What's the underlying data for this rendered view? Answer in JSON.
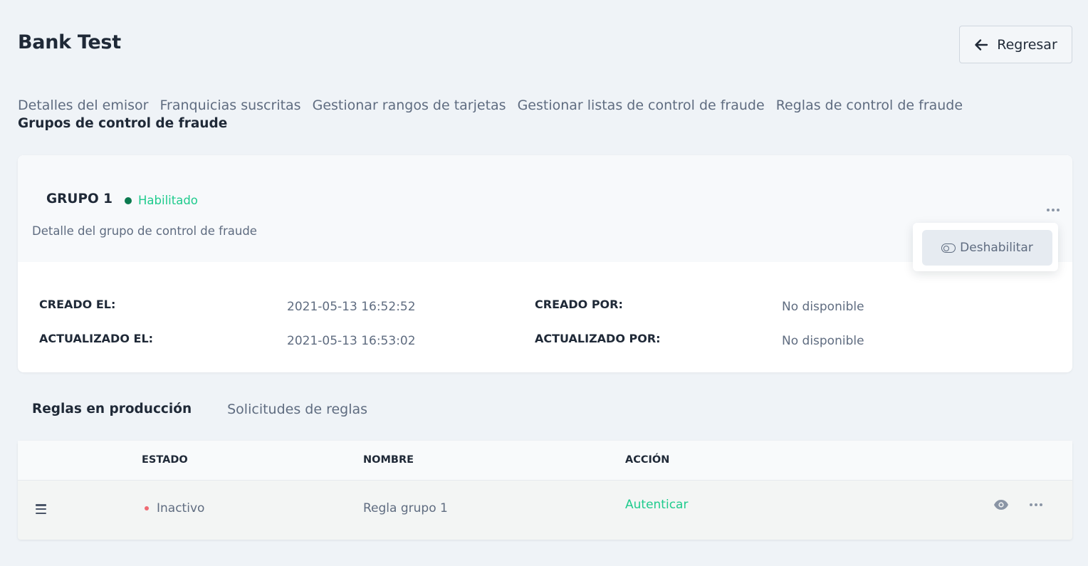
{
  "header": {
    "title": "Bank Test",
    "back_label": "Regresar"
  },
  "nav": {
    "tabs": [
      {
        "label": "Detalles del emisor"
      },
      {
        "label": "Franquicias suscritas"
      },
      {
        "label": "Gestionar rangos de tarjetas"
      },
      {
        "label": "Gestionar listas de control de fraude"
      },
      {
        "label": "Reglas de control de fraude"
      },
      {
        "label": "Grupos de control de fraude",
        "active": true
      }
    ]
  },
  "group": {
    "name": "GRUPO 1",
    "status": "Habilitado",
    "status_color": "#1fcb8d",
    "description": "Detalle del grupo de control de fraude",
    "menu_action": "Deshabilitar",
    "meta": {
      "created_at_label": "CREADO EL:",
      "created_at_value": "2021-05-13 16:52:52",
      "updated_at_label": "ACTUALIZADO EL:",
      "updated_at_value": "2021-05-13 16:53:02",
      "created_by_label": "CREADO POR:",
      "created_by_value": "No disponible",
      "updated_by_label": "ACTUALIZADO POR:",
      "updated_by_value": "No disponible"
    }
  },
  "sub_tabs": [
    {
      "label": "Reglas en producción",
      "active": true
    },
    {
      "label": "Solicitudes de reglas"
    }
  ],
  "table": {
    "columns": [
      "ESTADO",
      "NOMBRE",
      "ACCIÓN"
    ],
    "rows": [
      {
        "status": "Inactivo",
        "status_color": "#ef6a72",
        "name": "Regla grupo 1",
        "action": "Autenticar",
        "action_color": "#1fcb8d"
      }
    ]
  },
  "icons": {
    "back": "arrow-left-icon",
    "more": "more-horizontal-icon",
    "toggle": "toggle-off-icon",
    "drag": "drag-handle-icon",
    "view": "eye-icon"
  }
}
